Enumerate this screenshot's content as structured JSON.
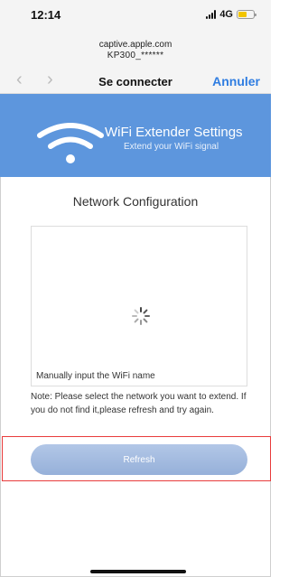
{
  "status_bar": {
    "time": "12:14",
    "network_type": "4G",
    "battery_color": "#f2c500"
  },
  "portal": {
    "domain": "captive.apple.com",
    "ssid": "KP300_******",
    "title": "Se connecter",
    "cancel_label": "Annuler",
    "back_icon": "chevron-left-icon",
    "forward_icon": "chevron-right-icon"
  },
  "banner": {
    "title": "WiFi Extender Settings",
    "subtitle": "Extend your WiFi signal",
    "icon": "wifi-icon",
    "background_color": "#5d96dd"
  },
  "content": {
    "section_title": "Network Configuration",
    "manual_input_label": "Manually input the WiFi name",
    "note": "Note: Please select the network you want to extend. If you do not find it,please refresh and try again.",
    "loading_icon": "spinner-icon"
  },
  "actions": {
    "refresh_label": "Refresh",
    "highlight_color": "#e83b3b"
  }
}
